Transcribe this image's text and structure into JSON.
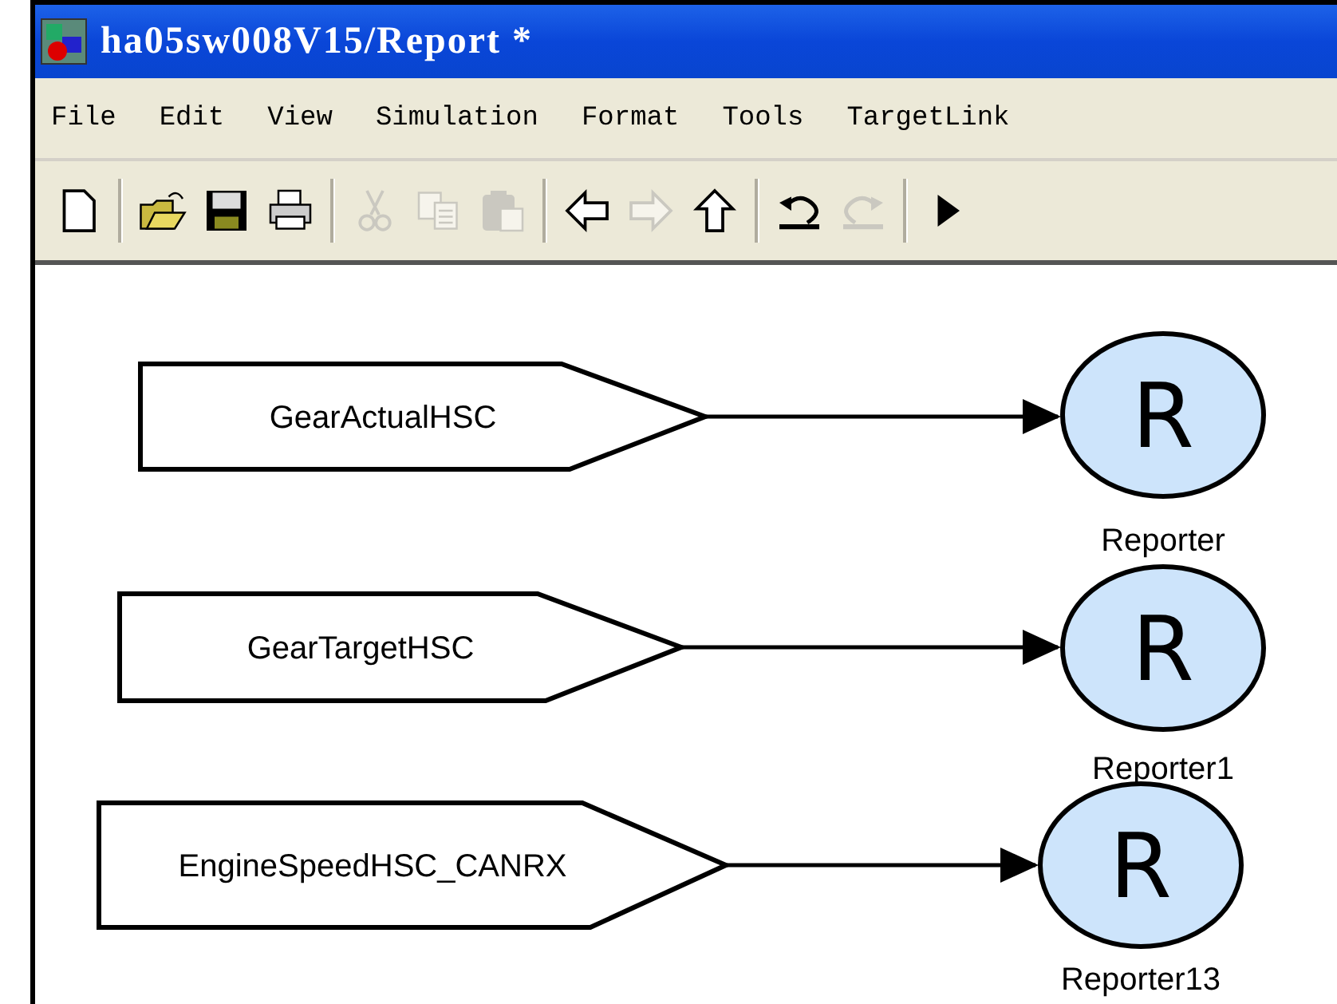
{
  "window": {
    "title": "ha05sw008V15/Report *"
  },
  "menu": [
    "File",
    "Edit",
    "View",
    "Simulation",
    "Format",
    "Tools",
    "TargetLink"
  ],
  "toolbar": [
    {
      "kind": "new",
      "disabled": false
    },
    {
      "kind": "sep"
    },
    {
      "kind": "open",
      "disabled": false
    },
    {
      "kind": "save",
      "disabled": false
    },
    {
      "kind": "print",
      "disabled": false
    },
    {
      "kind": "sep"
    },
    {
      "kind": "cut",
      "disabled": true
    },
    {
      "kind": "copy",
      "disabled": true
    },
    {
      "kind": "paste",
      "disabled": true
    },
    {
      "kind": "sep"
    },
    {
      "kind": "back",
      "disabled": false
    },
    {
      "kind": "forward",
      "disabled": true
    },
    {
      "kind": "up",
      "disabled": false
    },
    {
      "kind": "sep"
    },
    {
      "kind": "undo",
      "disabled": false
    },
    {
      "kind": "redo",
      "disabled": true
    },
    {
      "kind": "sep"
    },
    {
      "kind": "play",
      "disabled": false
    }
  ],
  "diagram": {
    "blocks": [
      {
        "signal": "GearActualHSC",
        "reporter": "R",
        "reporter_name": "Reporter"
      },
      {
        "signal": "GearTargetHSC",
        "reporter": "R",
        "reporter_name": "Reporter1"
      },
      {
        "signal": "EngineSpeedHSC_CANRX",
        "reporter": "R",
        "reporter_name": "Reporter13"
      }
    ]
  }
}
